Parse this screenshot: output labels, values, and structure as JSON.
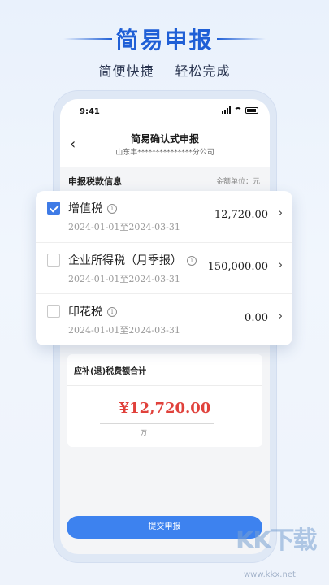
{
  "banner": {
    "title": "简易申报",
    "sub1": "简便快捷",
    "sub2": "轻松完成",
    "accent": "#1f5fd6"
  },
  "status_bar": {
    "time": "9:41"
  },
  "nav": {
    "title": "简易确认式申报",
    "company": "山东丰***************分公司"
  },
  "section": {
    "title": "申报税款信息",
    "unit": "金额单位：元"
  },
  "tax_items": [
    {
      "name": "增值税",
      "period": "2024-01-01至2024-03-31",
      "amount": "12,720.00",
      "checked": true
    },
    {
      "name": "企业所得税（月季报）",
      "period": "2024-01-01至2024-03-31",
      "amount": "150,000.00",
      "checked": false
    },
    {
      "name": "印花税",
      "period": "2024-01-01至2024-03-31",
      "amount": "0.00",
      "checked": false
    }
  ],
  "summary": {
    "title": "应补(退)税费额合计",
    "amount": "¥12,720.00",
    "unit": "万"
  },
  "submit_label": "提交申报",
  "watermark": {
    "logo": "KK下载",
    "url": "www.kkx.net"
  },
  "colors": {
    "primary": "#3d82ef",
    "amount_red": "#e0413b",
    "checkbox": "#3f7be6"
  }
}
